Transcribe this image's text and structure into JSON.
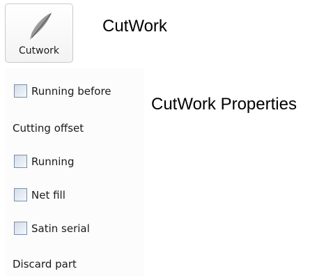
{
  "tool_button": {
    "label": "Cutwork",
    "icon": "quill-icon"
  },
  "tool_title": "CutWork",
  "panel_title": "CutWork Properties",
  "properties": [
    {
      "type": "checkbox",
      "label": "Running before",
      "checked": false
    },
    {
      "type": "label",
      "label": "Cutting offset"
    },
    {
      "type": "checkbox",
      "label": "Running",
      "checked": false
    },
    {
      "type": "checkbox",
      "label": "Net fill",
      "checked": false
    },
    {
      "type": "checkbox",
      "label": "Satin serial",
      "checked": false
    },
    {
      "type": "label",
      "label": "Discard part"
    }
  ]
}
